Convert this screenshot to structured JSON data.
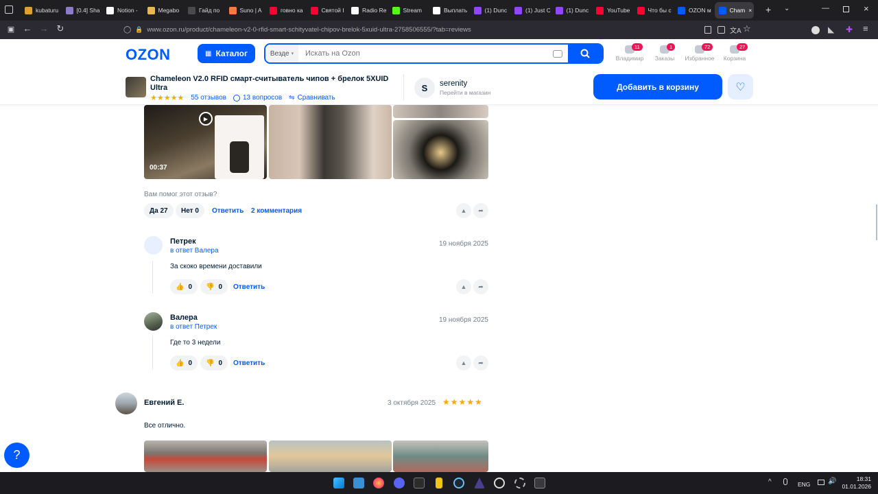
{
  "browser": {
    "tabs": [
      {
        "label": "kubaturu",
        "color": "#e0a030"
      },
      {
        "label": "[0.4] Sha",
        "color": "#8d7cc8"
      },
      {
        "label": "Notion -",
        "color": "#ffffff"
      },
      {
        "label": "Megabo",
        "color": "#e8b84a"
      },
      {
        "label": "Гайд по",
        "color": "#4a4a4a"
      },
      {
        "label": "Suno | A",
        "color": "#ff7a3d"
      },
      {
        "label": "говно ка",
        "color": "#ff0033"
      },
      {
        "label": "Святой I",
        "color": "#ff0033"
      },
      {
        "label": "Radio Re",
        "color": "#ffffff"
      },
      {
        "label": "Stream",
        "color": "#53fc18"
      },
      {
        "label": "Выплать",
        "color": "#ffffff"
      },
      {
        "label": "(1) Dunc",
        "color": "#9146ff"
      },
      {
        "label": "(1) Just C",
        "color": "#9146ff"
      },
      {
        "label": "(1) Dunc",
        "color": "#9146ff"
      },
      {
        "label": "YouTube",
        "color": "#ff0033"
      },
      {
        "label": "Что бы с",
        "color": "#ff0033"
      },
      {
        "label": "OZON м",
        "color": "#005bff"
      },
      {
        "label": "Cham",
        "color": "#005bff"
      }
    ],
    "url": "www.ozon.ru/product/chameleon-v2-0-rfid-smart-schityvatel-chipov-brelok-5xuid-ultra-2758506555/?tab=reviews"
  },
  "header": {
    "logo": "OZON",
    "catalog_label": "Каталог",
    "search_scope": "Везде",
    "search_placeholder": "Искать на Ozon",
    "items": [
      {
        "label": "Владимир",
        "badge": "11"
      },
      {
        "label": "Заказы",
        "badge": "1"
      },
      {
        "label": "Избранное",
        "badge": "72"
      },
      {
        "label": "Корзина",
        "badge": "27"
      }
    ]
  },
  "product": {
    "title": "Chameleon V2.0 RFID смарт-считыватель чипов + брелок 5XUID Ultra",
    "rating_stars": 5,
    "reviews": "55 отзывов",
    "questions": "13 вопросов",
    "compare": "Сравнивать",
    "seller_initial": "S",
    "seller_name": "serenity",
    "seller_link": "Перейти в магазин",
    "add_to_cart": "Добавить в корзину"
  },
  "review_block": {
    "video_duration": "00:37",
    "helpful_question": "Вам помог этот отзыв?",
    "yes_label": "Да 27",
    "no_label": "Нет 0",
    "reply_label": "Ответить",
    "comments_label": "2 комментария"
  },
  "comments": [
    {
      "author": "Петрек",
      "reply_to": "в ответ Валера",
      "date": "19 ноября 2025",
      "text": "За скоко времени доставили",
      "likes": "0",
      "dislikes": "0",
      "reply": "Ответить"
    },
    {
      "author": "Валера",
      "reply_to": "в ответ Петрек",
      "date": "19 ноября 2025",
      "text": "Где то 3 недели",
      "likes": "0",
      "dislikes": "0",
      "reply": "Ответить"
    }
  ],
  "next_review": {
    "author": "Евгений Е.",
    "date": "3 октября 2025",
    "rating": 5,
    "text": "Все отлично."
  },
  "taskbar": {
    "lang": "ENG",
    "time": "18:31",
    "date": "01.01.2026"
  },
  "colors": {
    "accent": "#005bff",
    "star": "#ffa800",
    "badge": "#f91155"
  }
}
